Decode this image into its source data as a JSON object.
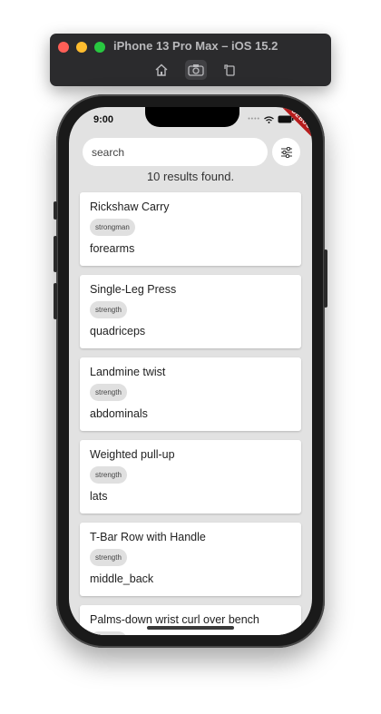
{
  "simulator": {
    "title": "iPhone 13 Pro Max – iOS 15.2",
    "tools": [
      {
        "icon": "home-icon"
      },
      {
        "icon": "screenshot-icon"
      },
      {
        "icon": "rotate-icon"
      }
    ]
  },
  "status_bar": {
    "time": "9:00",
    "debug_label": "DEBUG"
  },
  "search": {
    "placeholder": "search",
    "value": ""
  },
  "filter_button": {
    "icon": "sliders-icon"
  },
  "results": {
    "count_text": "10 results found."
  },
  "exercises": [
    {
      "name": "Rickshaw Carry",
      "category": "strongman",
      "muscle": "forearms"
    },
    {
      "name": "Single-Leg Press",
      "category": "strength",
      "muscle": "quadriceps"
    },
    {
      "name": "Landmine twist",
      "category": "strength",
      "muscle": "abdominals"
    },
    {
      "name": "Weighted pull-up",
      "category": "strength",
      "muscle": "lats"
    },
    {
      "name": "T-Bar Row with Handle",
      "category": "strength",
      "muscle": "middle_back"
    },
    {
      "name": "Palms-down wrist curl over bench",
      "category": "strength",
      "muscle": ""
    }
  ],
  "colors": {
    "screen_background": "#e2e2e2",
    "card_background": "#ffffff",
    "chip_background": "#e0e0e0",
    "debug_banner": "#b71c1c"
  }
}
